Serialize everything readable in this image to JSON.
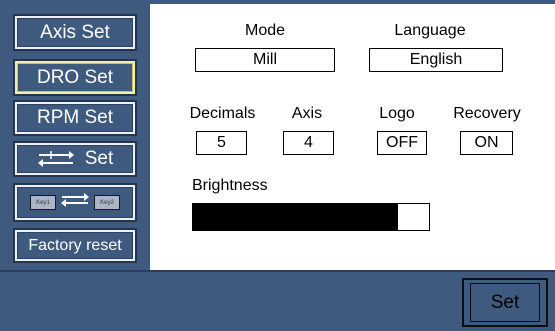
{
  "sidebar": {
    "items": [
      {
        "label": "Axis Set"
      },
      {
        "label": "DRO Set"
      },
      {
        "label": "RPM Set"
      },
      {
        "label": "Set"
      },
      {
        "key1": "Key1",
        "key2": "Key2"
      },
      {
        "label": "Factory reset"
      }
    ],
    "active_index": 1
  },
  "settings": {
    "mode": {
      "label": "Mode",
      "value": "Mill"
    },
    "language": {
      "label": "Language",
      "value": "English"
    },
    "decimals": {
      "label": "Decimals",
      "value": "5"
    },
    "axis": {
      "label": "Axis",
      "value": "4"
    },
    "logo": {
      "label": "Logo",
      "value": "OFF"
    },
    "recovery": {
      "label": "Recovery",
      "value": "ON"
    },
    "brightness": {
      "label": "Brightness",
      "level_fraction": 0.87
    }
  },
  "footer": {
    "set_label": "Set"
  },
  "colors": {
    "panel_bg": "#3f5a7f",
    "content_bg": "#ffffff",
    "active_border": "#f4f0a8"
  }
}
